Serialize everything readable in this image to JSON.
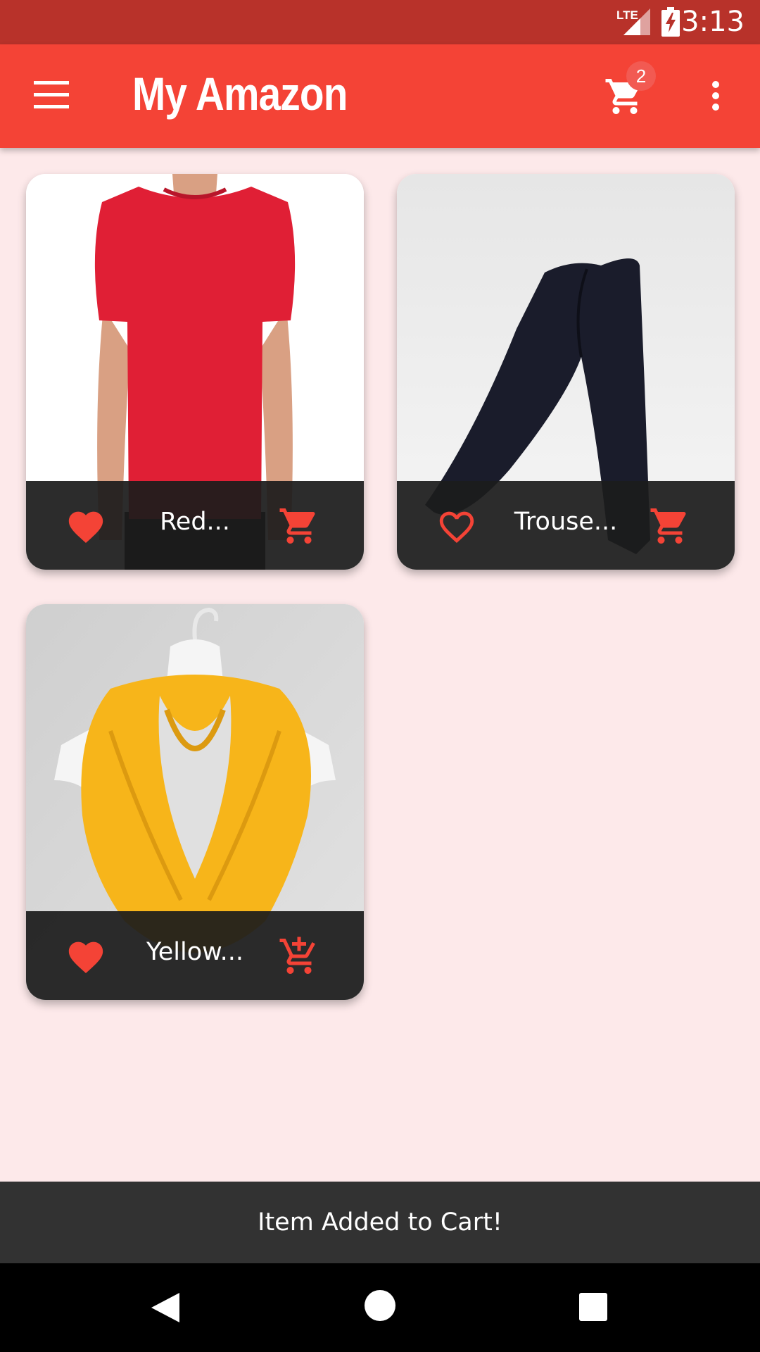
{
  "status_bar": {
    "network": "LTE",
    "time": "3:13"
  },
  "app_bar": {
    "title": "My Amazon",
    "cart_count": "2"
  },
  "products": [
    {
      "name": "Red...",
      "favorited": true,
      "cart_icon": "cart-icon"
    },
    {
      "name": "Trouse...",
      "favorited": false,
      "cart_icon": "cart-icon"
    },
    {
      "name": "Yellow...",
      "favorited": true,
      "cart_icon": "add-to-cart-icon"
    }
  ],
  "snackbar": {
    "message": "Item Added to Cart!"
  },
  "colors": {
    "primary": "#f44336",
    "status_bar": "#b8322a",
    "accent": "#f44336",
    "background": "#fde9ea"
  }
}
